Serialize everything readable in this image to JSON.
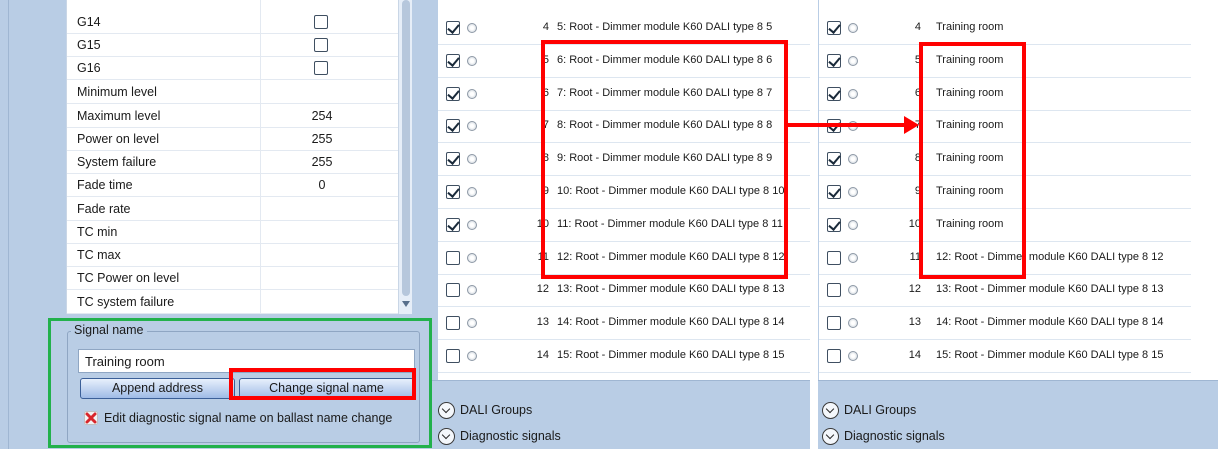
{
  "properties": [
    {
      "name": "G14",
      "type": "check"
    },
    {
      "name": "G15",
      "type": "check"
    },
    {
      "name": "G16",
      "type": "check"
    },
    {
      "name": "Minimum level",
      "value": ""
    },
    {
      "name": "Maximum level",
      "value": "254"
    },
    {
      "name": "Power on level",
      "value": "255"
    },
    {
      "name": "System failure",
      "value": "255"
    },
    {
      "name": "Fade time",
      "value": "0"
    },
    {
      "name": "Fade rate",
      "value": ""
    },
    {
      "name": "TC min",
      "value": ""
    },
    {
      "name": "TC max",
      "value": ""
    },
    {
      "name": "TC Power on level",
      "value": ""
    },
    {
      "name": "TC system failure",
      "value": ""
    }
  ],
  "signal_panel": {
    "legend": "Signal name",
    "input_value": "Training room",
    "append_label": "Append address",
    "change_label": "Change signal name",
    "edit_diag_label": "Edit diagnostic signal name on ballast name change"
  },
  "middle_list": [
    {
      "checked": true,
      "num": "4",
      "text": "5: Root - Dimmer module K60  DALI type 8 5"
    },
    {
      "checked": true,
      "num": "5",
      "text": "6: Root - Dimmer module K60  DALI type 8 6"
    },
    {
      "checked": true,
      "num": "6",
      "text": "7: Root - Dimmer module K60  DALI type 8 7"
    },
    {
      "checked": true,
      "num": "7",
      "text": "8: Root - Dimmer module K60  DALI type 8 8"
    },
    {
      "checked": true,
      "num": "8",
      "text": "9: Root - Dimmer module K60  DALI type 8 9"
    },
    {
      "checked": true,
      "num": "9",
      "text": "10: Root - Dimmer module K60  DALI type 8 10"
    },
    {
      "checked": true,
      "num": "10",
      "text": "11: Root - Dimmer module K60  DALI type 8 11"
    },
    {
      "checked": false,
      "num": "11",
      "text": "12: Root - Dimmer module K60  DALI type 8 12"
    },
    {
      "checked": false,
      "num": "12",
      "text": "13: Root - Dimmer module K60  DALI type 8 13"
    },
    {
      "checked": false,
      "num": "13",
      "text": "14: Root - Dimmer module K60  DALI type 8 14"
    },
    {
      "checked": false,
      "num": "14",
      "text": "15: Root - Dimmer module K60  DALI type 8 15"
    }
  ],
  "right_list": [
    {
      "checked": true,
      "num": "4",
      "text": "Training room"
    },
    {
      "checked": true,
      "num": "5",
      "text": "Training room"
    },
    {
      "checked": true,
      "num": "6",
      "text": "Training room"
    },
    {
      "checked": true,
      "num": "7",
      "text": "Training room"
    },
    {
      "checked": true,
      "num": "8",
      "text": "Training room"
    },
    {
      "checked": true,
      "num": "9",
      "text": "Training room"
    },
    {
      "checked": true,
      "num": "10",
      "text": "Training room"
    },
    {
      "checked": false,
      "num": "11",
      "text": "12: Root - Dimmer module K60  DALI type 8 12"
    },
    {
      "checked": false,
      "num": "12",
      "text": "13: Root - Dimmer module K60  DALI type 8 13"
    },
    {
      "checked": false,
      "num": "13",
      "text": "14: Root - Dimmer module K60  DALI type 8 14"
    },
    {
      "checked": false,
      "num": "14",
      "text": "15: Root - Dimmer module K60  DALI type 8 15"
    }
  ],
  "expanders": {
    "dali_groups": "DALI Groups",
    "diagnostic_signals": "Diagnostic signals"
  },
  "colors": {
    "panel_blue": "#b9cde5",
    "highlight_red": "#ff0000",
    "group_green": "#22b14c"
  }
}
